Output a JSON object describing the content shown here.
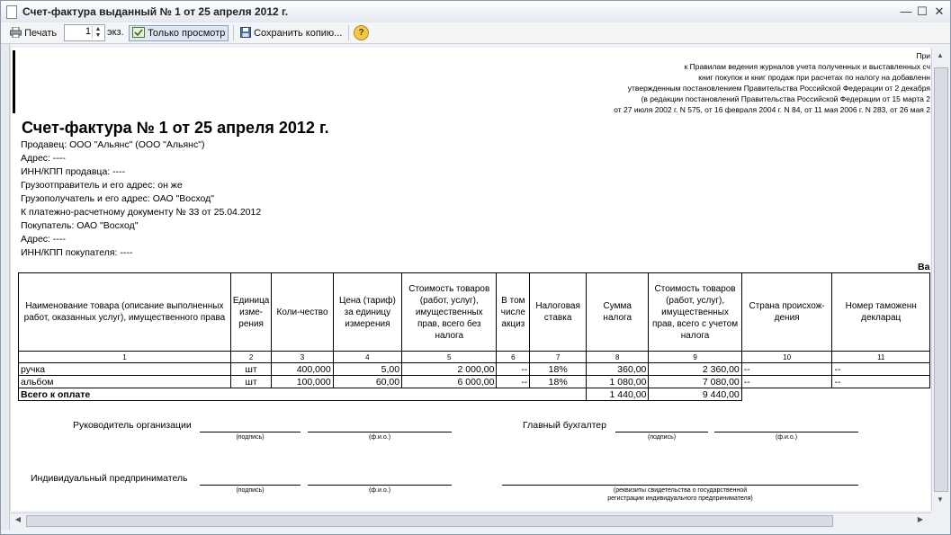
{
  "window": {
    "title": "Счет-фактура выданный № 1 от 25 апреля 2012 г.",
    "minimize": "—",
    "maximize": "☐",
    "close": "✕"
  },
  "toolbar": {
    "print_label": "Печать",
    "copies_value": "1",
    "copies_unit": "экз.",
    "view_only_label": "Только просмотр",
    "save_copy_label": "Сохранить копию...",
    "help_label": "?"
  },
  "header_notes": [
    "При",
    "к Правилам ведения журналов учета полученных и выставленных сч",
    "книг покупок и книг продаж при расчетах по налогу на добавленн",
    "утвержденным постановлением Правительства Российской Федерации от 2 декабря",
    "(в редакции постановлений Правительства Российской Федерации от 15 марта 2",
    "от 27 июля 2002 г. N 575, от 16 февраля 2004 г. N 84, от 11 мая 2006 г. N 283, от 26 мая 2"
  ],
  "document": {
    "title": "Счет-фактура № 1 от 25 апреля 2012 г.",
    "seller": "Продавец: ООО \"Альянс\" (ООО \"Альянс\")",
    "seller_address": "Адрес: ----",
    "seller_inn": "ИНН/КПП продавца: ----",
    "shipper": "Грузоотправитель и его адрес: он же",
    "consignee": "Грузополучатель и его адрес: ОАО \"Восход\"",
    "payment_doc": "К платежно-расчетному документу № 33 от 25.04.2012",
    "buyer": "Покупатель: ОАО \"Восход\"",
    "buyer_address": "Адрес: ----",
    "buyer_inn": "ИНН/КПП покупателя: ----",
    "currency_label": "Ва"
  },
  "table": {
    "headers": [
      "Наименование товара (описание выполненных работ, оказанных услуг), имущественного права",
      "Единица изме-рения",
      "Коли-чество",
      "Цена (тариф) за единицу измерения",
      "Стоимость товаров (работ, услуг), имущественных прав, всего без налога",
      "В том числе акциз",
      "Налоговая ставка",
      "Сумма налога",
      "Стоимость товаров (работ, услуг), имущественных прав, всего с учетом налога",
      "Страна происхож-дения",
      "Номер таможенн декларац"
    ],
    "col_numbers": [
      "1",
      "2",
      "3",
      "4",
      "5",
      "6",
      "7",
      "8",
      "9",
      "10",
      "11"
    ],
    "rows": [
      [
        "ручка",
        "шт",
        "400,000",
        "5,00",
        "2 000,00",
        "--",
        "18%",
        "360,00",
        "2 360,00",
        "--",
        "--"
      ],
      [
        "альбом",
        "шт",
        "100,000",
        "60,00",
        "6 000,00",
        "--",
        "18%",
        "1 080,00",
        "7 080,00",
        "--",
        "--"
      ]
    ],
    "total_label": "Всего к оплате",
    "total_tax": "1 440,00",
    "total_sum": "9 440,00"
  },
  "signatures": {
    "head_label": "Руководитель организации",
    "chief_accountant_label": "Главный бухгалтер",
    "entrepreneur_label": "Индивидуальный предприниматель",
    "signature_caption": "(подпись)",
    "name_caption": "(ф.и.о.)",
    "certificate_caption_1": "(реквизиты свидетельства о государственной",
    "certificate_caption_2": "регистрации индивидуального предпринимателя)"
  }
}
